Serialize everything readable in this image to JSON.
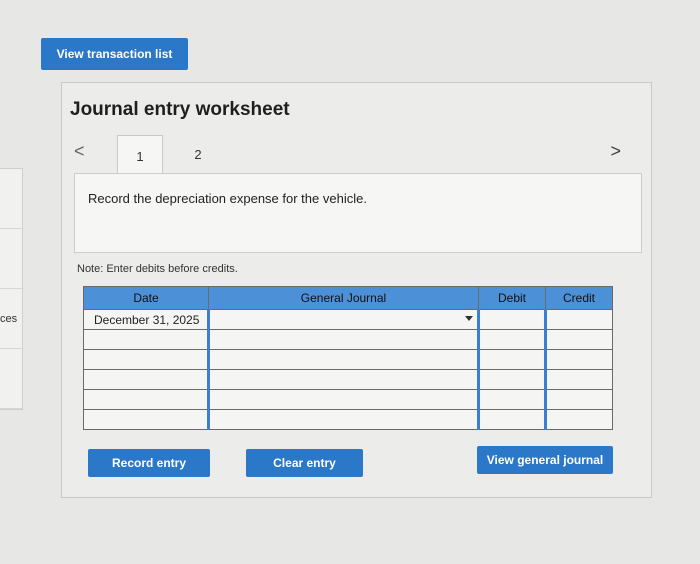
{
  "side_tab": {
    "label": "ces"
  },
  "top_button": {
    "label": "View transaction list"
  },
  "worksheet": {
    "title": "Journal entry worksheet",
    "nav_prev": "<",
    "nav_next": ">",
    "tabs": [
      {
        "label": "1",
        "active": true
      },
      {
        "label": "2",
        "active": false
      }
    ],
    "instruction": "Record the depreciation expense for the vehicle.",
    "note": "Note: Enter debits before credits.",
    "table": {
      "headers": [
        "Date",
        "General Journal",
        "Debit",
        "Credit"
      ],
      "rows": [
        [
          "December 31, 2025",
          "",
          "",
          ""
        ],
        [
          "",
          "",
          "",
          ""
        ],
        [
          "",
          "",
          "",
          ""
        ],
        [
          "",
          "",
          "",
          ""
        ],
        [
          "",
          "",
          "",
          ""
        ],
        [
          "",
          "",
          "",
          ""
        ]
      ]
    },
    "buttons": {
      "record": "Record entry",
      "clear": "Clear entry",
      "view_general": "View general journal"
    }
  },
  "colors": {
    "accent": "#2b78c9",
    "header": "#4c90d8"
  }
}
